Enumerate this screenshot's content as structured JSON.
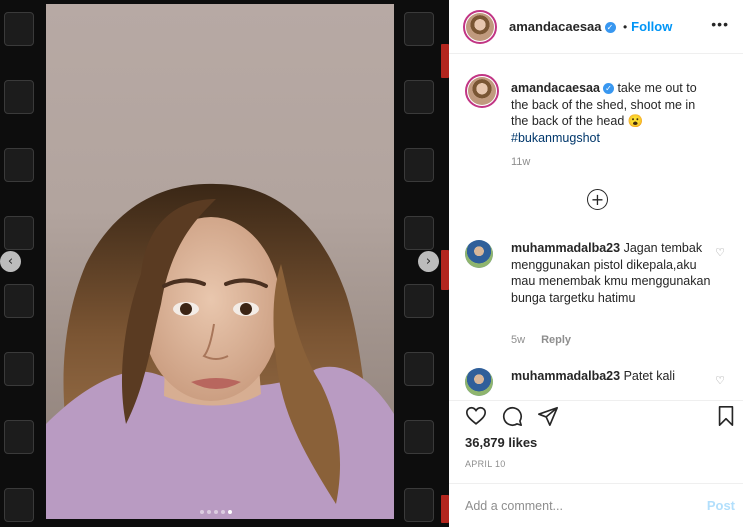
{
  "post": {
    "author": "amandacaesaa",
    "follow_separator": "•",
    "follow_label": "Follow",
    "more_icon": "more-icon",
    "verified_icon": "verified-badge-icon",
    "caption": {
      "username": "amandacaesaa",
      "text": "take me out to the back of the shed, shoot me in the back of the head",
      "emoji": "😮",
      "hashtag": "#bukanmugshot",
      "age": "11w"
    },
    "load_more_icon": "plus-circle-icon",
    "comments": [
      {
        "username": "muhammadalba23",
        "text": "Jagan tembak menggunakan pistol dikepala,aku mau menembak kmu menggunakan bunga targetku hatimu",
        "age": "5w",
        "reply_label": "Reply"
      },
      {
        "username": "muhammadalba23",
        "text": "Patet kali",
        "age": "",
        "reply_label": ""
      }
    ],
    "likes": "36,879 likes",
    "date": "APRIL 10",
    "add_comment": {
      "placeholder": "Add a comment...",
      "post_label": "Post"
    }
  },
  "media": {
    "slide_count": 5,
    "active_slide": 5,
    "prev_icon": "chevron-left-icon",
    "next_icon": "chevron-right-icon"
  },
  "colors": {
    "accent": "#0095f6",
    "post_disabled": "#b2dffc",
    "hashtag": "#00376b",
    "muted": "#8e8e8e",
    "film_red": "#b3261e"
  }
}
